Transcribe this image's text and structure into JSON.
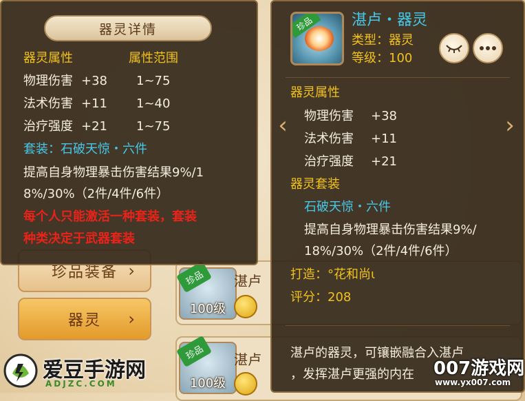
{
  "left_detail": {
    "title": "器灵详情",
    "attr_header": "器灵属性",
    "range_header": "属性范围",
    "attributes": [
      {
        "name": "物理伤害",
        "value": "+38",
        "range": "1~75"
      },
      {
        "name": "法术伤害",
        "value": "+11",
        "range": "1~40"
      },
      {
        "name": "治疗强度",
        "value": "+21",
        "range": "1~75"
      }
    ],
    "set_label": "套装：石破天惊・六件",
    "set_desc_line1": "提高自身物理暴击伤害结果9%/1",
    "set_desc_line2": "8%/30%（2件/4件/6件）",
    "warning_line1": "每个人只能激活一种套装，套装",
    "warning_line2": "种类决定于武器套装"
  },
  "right_detail": {
    "item_tag": "珍品",
    "name": "湛卢・器灵",
    "type_label": "类型：器灵",
    "level_label": "等级：",
    "level_value": "100",
    "attr_header": "器灵属性",
    "attributes": [
      {
        "name": "物理伤害",
        "value": "+38"
      },
      {
        "name": "法术伤害",
        "value": "+11"
      },
      {
        "name": "治疗强度",
        "value": "+21"
      }
    ],
    "set_header": "器灵套装",
    "set_name": "石破天惊・六件",
    "set_desc_line1": "提高自身物理暴击伤害结果9%/",
    "set_desc_line2": "18%/30%（2件/4件/6件）",
    "forge_label": "打造：",
    "forge_value": "°花和尚ι",
    "score_label": "评分：",
    "score_value": "208",
    "desc_line1": "湛卢的器灵，可镶嵌融合入湛卢",
    "desc_line2": "，发挥湛卢更强的内在"
  },
  "background": {
    "left_buttons": [
      "珍品装备",
      "器灵"
    ],
    "rows": [
      {
        "tag": "珍品",
        "level": "100级",
        "name": "湛卢"
      },
      {
        "tag": "珍品",
        "level": "100级",
        "name": "湛卢"
      }
    ]
  },
  "watermarks": {
    "left_title": "爱豆手游网",
    "left_url": "ADJZC.COM",
    "right_title": "007游戏网",
    "right_url": "www.yx007.com"
  },
  "icons": [
    "eye-closed-icon",
    "more-dots-icon",
    "chevron-left-icon",
    "chevron-right-icon",
    "coin-icon"
  ],
  "colors": {
    "panel_bg": "#34281a",
    "yellow_text": "#f2c21c",
    "cyan_text": "#45c8ea",
    "red_text": "#e8231a",
    "white_text": "#f4eee0"
  }
}
